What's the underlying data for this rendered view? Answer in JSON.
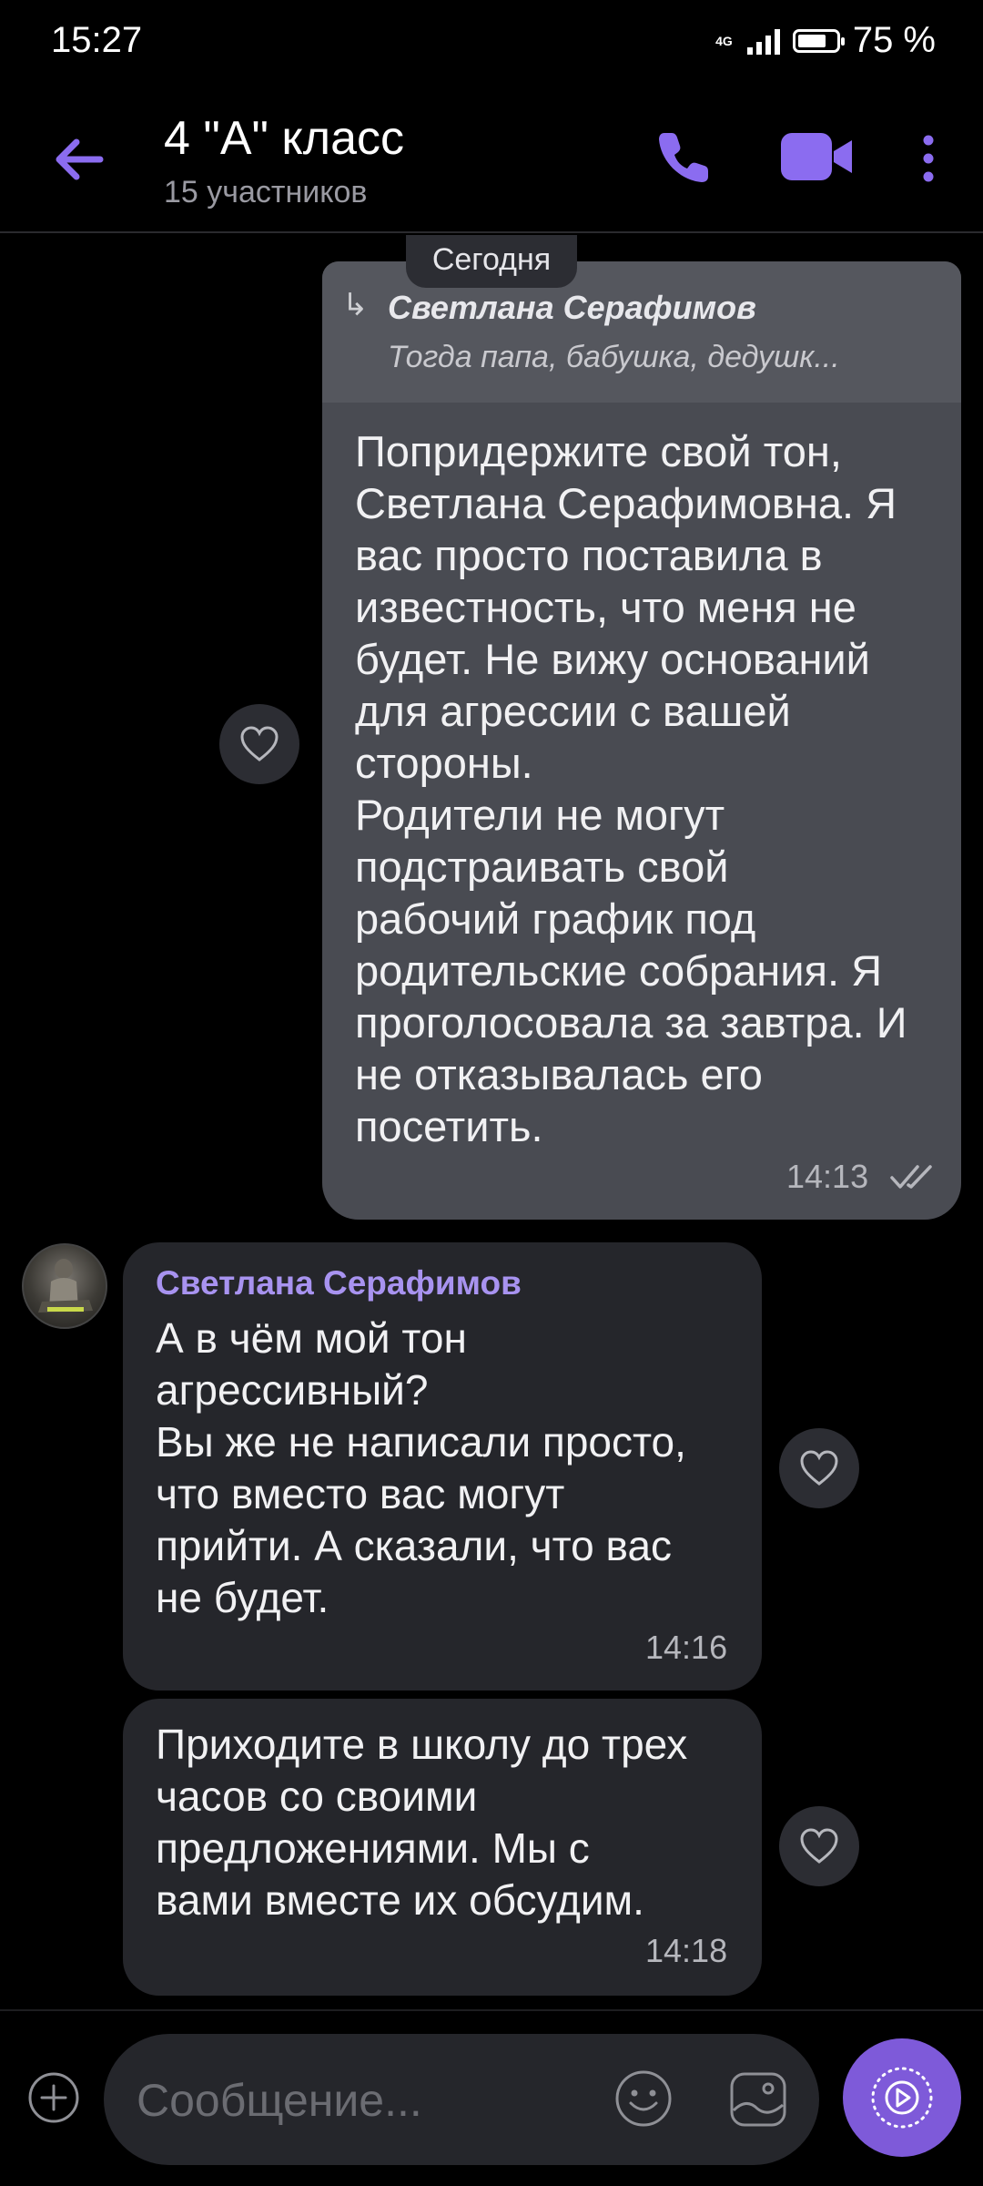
{
  "status_bar": {
    "time": "15:27",
    "network": "4G",
    "battery": "75 %",
    "battery_level": 0.75
  },
  "header": {
    "title": "4 \"А\" класс",
    "subtitle": "15 участников"
  },
  "date_chip": "Сегодня",
  "messages": {
    "out_1": {
      "quote_name": "Светлана Серафимов",
      "quote_text": "Тогда папа, бабушка, дедушк...",
      "lines": [
        "Попридержите свой тон,",
        "Светлана Серафимовна. Я",
        "вас просто поставила в",
        "известность, что меня не",
        "будет. Не вижу оснований",
        "для агрессии с вашей",
        "стороны.",
        "Родители не могут",
        "подстраивать свой",
        "рабочий график под",
        "родительские собрания. Я",
        "проголосовала за завтра. И",
        "не отказывалась его",
        "посетить."
      ],
      "time": "14:13"
    },
    "in_1": {
      "sender": "Светлана Серафимов",
      "lines": [
        "А в чём мой тон",
        "агрессивный?",
        "Вы же не написали просто,",
        "что вместо вас могут",
        "прийти. А сказали, что вас",
        "не будет."
      ],
      "time": "14:16"
    },
    "in_2": {
      "lines": [
        "Приходите в школу до трех",
        "часов со своими",
        "предложениями. Мы с",
        "вами вместе их обсудим."
      ],
      "time": "14:18"
    }
  },
  "composer": {
    "placeholder": "Сообщение..."
  },
  "colors": {
    "accent": "#8b6cf0",
    "outgoing_bubble": "#494b52",
    "incoming_bubble": "#25262b",
    "sender_name": "#a893f0"
  }
}
